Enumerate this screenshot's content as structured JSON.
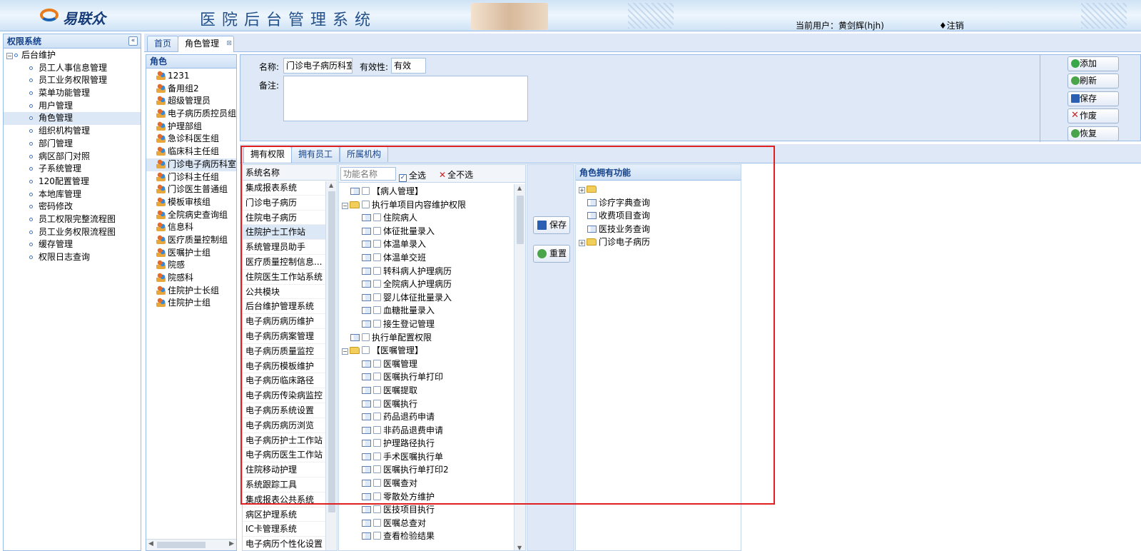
{
  "header": {
    "logo_text": "易联众",
    "system_title": "医院后台管理系统",
    "current_user": "当前用户：黄剑辉(hjh)",
    "logout": "♦注销"
  },
  "sidebar": {
    "title": "权限系统",
    "root": "后台维护",
    "items": [
      {
        "label": "员工人事信息管理"
      },
      {
        "label": "员工业务权限管理"
      },
      {
        "label": "菜单功能管理"
      },
      {
        "label": "用户管理"
      },
      {
        "label": "角色管理",
        "selected": true
      },
      {
        "label": "组织机构管理"
      },
      {
        "label": "部门管理"
      },
      {
        "label": "病区部门对照"
      },
      {
        "label": "子系统管理"
      },
      {
        "label": "120配置管理"
      },
      {
        "label": "本地库管理"
      },
      {
        "label": "密码修改"
      },
      {
        "label": "员工权限完整流程图"
      },
      {
        "label": "员工业务权限流程图"
      },
      {
        "label": "缓存管理"
      },
      {
        "label": "权限日志查询"
      }
    ]
  },
  "main_tabs": [
    {
      "label": "首页"
    },
    {
      "label": "角色管理",
      "active": true
    }
  ],
  "roles": {
    "title": "角色",
    "items": [
      {
        "label": "1231"
      },
      {
        "label": "备用组2"
      },
      {
        "label": "超级管理员"
      },
      {
        "label": "电子病历质控员组"
      },
      {
        "label": "护理部组"
      },
      {
        "label": "急诊科医生组"
      },
      {
        "label": "临床科主任组"
      },
      {
        "label": "门诊电子病历科室",
        "selected": true
      },
      {
        "label": "门诊科主任组"
      },
      {
        "label": "门诊医生普通组"
      },
      {
        "label": "模板审核组"
      },
      {
        "label": "全院病史查询组"
      },
      {
        "label": "信息科"
      },
      {
        "label": "医疗质量控制组"
      },
      {
        "label": "医嘱护士组"
      },
      {
        "label": "院感"
      },
      {
        "label": "院感科"
      },
      {
        "label": "住院护士长组"
      },
      {
        "label": "住院护士组"
      }
    ]
  },
  "form": {
    "name_label": "名称:",
    "name_value": "门诊电子病历科室",
    "validity_label": "有效性:",
    "validity_value": "有效",
    "remark_label": "备注:",
    "remark_value": ""
  },
  "toolbar": {
    "add": "添加",
    "refresh": "刷新",
    "save": "保存",
    "void": "作废",
    "restore": "恢复"
  },
  "sub_tabs": [
    {
      "label": "拥有权限",
      "active": true
    },
    {
      "label": "拥有员工"
    },
    {
      "label": "所属机构"
    }
  ],
  "systems": {
    "header": "系统名称",
    "items": [
      {
        "label": "集成报表系统"
      },
      {
        "label": "门诊电子病历"
      },
      {
        "label": "住院电子病历"
      },
      {
        "label": "住院护士工作站",
        "selected": true
      },
      {
        "label": "系统管理员助手"
      },
      {
        "label": "医疗质量控制信息..."
      },
      {
        "label": "住院医生工作站系统"
      },
      {
        "label": "公共模块"
      },
      {
        "label": "后台维护管理系统"
      },
      {
        "label": "电子病历病历维护"
      },
      {
        "label": "电子病历病案管理"
      },
      {
        "label": "电子病历质量监控"
      },
      {
        "label": "电子病历模板维护"
      },
      {
        "label": "电子病历临床路径"
      },
      {
        "label": "电子病历传染病监控"
      },
      {
        "label": "电子病历系统设置"
      },
      {
        "label": "电子病历病历浏览"
      },
      {
        "label": "电子病历护士工作站"
      },
      {
        "label": "电子病历医生工作站"
      },
      {
        "label": "住院移动护理"
      },
      {
        "label": "系统跟踪工具"
      },
      {
        "label": "集成报表公共系统"
      },
      {
        "label": "病区护理系统"
      },
      {
        "label": "IC卡管理系统"
      },
      {
        "label": "电子病历个性化设置"
      }
    ]
  },
  "functions": {
    "search_placeholder": "功能名称",
    "select_all": "全选",
    "select_none": "全不选",
    "items": [
      {
        "label": "【病人管理】",
        "level": 1,
        "type": "leaf"
      },
      {
        "label": "执行单项目内容维护权限",
        "level": 0,
        "type": "folder"
      },
      {
        "label": "住院病人",
        "level": 2,
        "type": "leaf"
      },
      {
        "label": "体征批量录入",
        "level": 2,
        "type": "leaf"
      },
      {
        "label": "体温单录入",
        "level": 2,
        "type": "leaf"
      },
      {
        "label": "体温单交班",
        "level": 2,
        "type": "leaf"
      },
      {
        "label": "转科病人护理病历",
        "level": 2,
        "type": "leaf"
      },
      {
        "label": "全院病人护理病历",
        "level": 2,
        "type": "leaf"
      },
      {
        "label": "婴儿体征批量录入",
        "level": 2,
        "type": "leaf"
      },
      {
        "label": "血糖批量录入",
        "level": 2,
        "type": "leaf"
      },
      {
        "label": "接生登记管理",
        "level": 2,
        "type": "leaf"
      },
      {
        "label": "执行单配置权限",
        "level": 1,
        "type": "leaf"
      },
      {
        "label": "【医嘱管理】",
        "level": 0,
        "type": "folder"
      },
      {
        "label": "医嘱管理",
        "level": 2,
        "type": "leaf"
      },
      {
        "label": "医嘱执行单打印",
        "level": 2,
        "type": "leaf"
      },
      {
        "label": "医嘱提取",
        "level": 2,
        "type": "leaf"
      },
      {
        "label": "医嘱执行",
        "level": 2,
        "type": "leaf"
      },
      {
        "label": "药品退药申请",
        "level": 2,
        "type": "leaf"
      },
      {
        "label": "非药品退费申请",
        "level": 2,
        "type": "leaf"
      },
      {
        "label": "护理路径执行",
        "level": 2,
        "type": "leaf"
      },
      {
        "label": "手术医嘱执行单",
        "level": 2,
        "type": "leaf"
      },
      {
        "label": "医嘱执行单打印2",
        "level": 2,
        "type": "leaf"
      },
      {
        "label": "医嘱查对",
        "level": 2,
        "type": "leaf"
      },
      {
        "label": "零散处方维护",
        "level": 2,
        "type": "leaf"
      },
      {
        "label": "医技项目执行",
        "level": 2,
        "type": "leaf"
      },
      {
        "label": "医嘱总查对",
        "level": 2,
        "type": "leaf"
      },
      {
        "label": "查看检验结果",
        "level": 2,
        "type": "leaf"
      }
    ]
  },
  "middle_buttons": {
    "save": "保存",
    "reset": "重置"
  },
  "role_functions": {
    "title": "角色拥有功能",
    "items": [
      {
        "label": "",
        "level": 0,
        "type": "folder"
      },
      {
        "label": "诊疗字典查询",
        "level": 1,
        "type": "leaf"
      },
      {
        "label": "收费项目查询",
        "level": 1,
        "type": "leaf"
      },
      {
        "label": "医技业务查询",
        "level": 1,
        "type": "leaf"
      },
      {
        "label": "门诊电子病历",
        "level": 0,
        "type": "folder"
      }
    ]
  },
  "colors": {
    "accent": "#15428b",
    "border": "#99bbe8",
    "highlight": "#e02020"
  }
}
